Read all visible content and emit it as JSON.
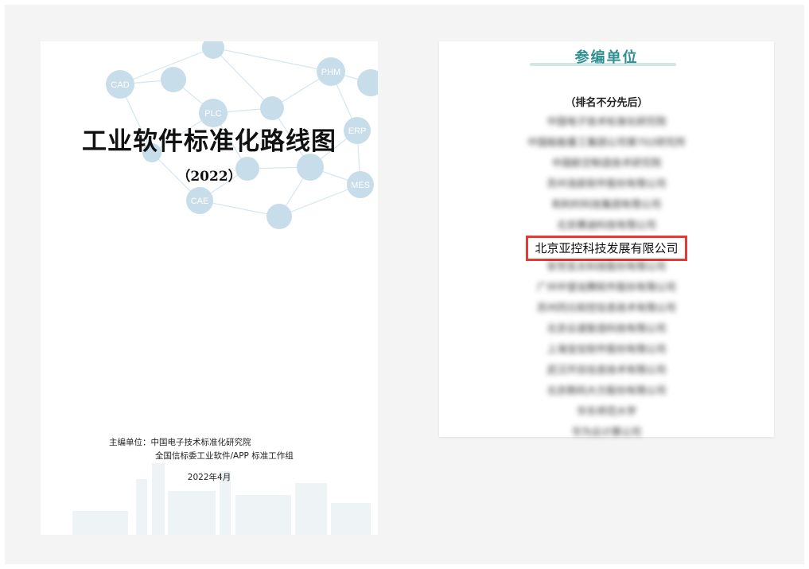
{
  "cover": {
    "title": "工业软件标准化路线图",
    "year": "（2022）",
    "network_labels": [
      "CAD",
      "PLC",
      "PHM",
      "ERP",
      "CAE",
      "MES"
    ],
    "chief_editor_label": "主编单位：",
    "chief_editor_1": "中国电子技术标准化研究院",
    "chief_editor_2": "全国信标委工业软件/APP 标准工作组",
    "date": "2022年4月"
  },
  "units": {
    "header": "参编单位",
    "note": "（排名不分先后）",
    "items": [
      "中国电子技术标准化研究院",
      "中国船舶重工集团公司第702研究所",
      "中国航空制造技术研究院",
      "苏州浩辰软件股份有限公司",
      "和利时科技集团有限公司",
      "北京赛迪科技有限公司",
      "北京亚控科技发展有限公司",
      "安世亚太科技股份有限公司",
      "广州中望龙腾软件股份有限公司",
      "苏州同元软控信息技术有限公司",
      "北京云道智造科技有限公司",
      "上海宝信软件股份有限公司",
      "武汉开目信息技术有限公司",
      "北京数码大方股份有限公司",
      "华东师范大学",
      "华为云计算公司"
    ],
    "highlighted_index": 6
  },
  "colors": {
    "accent": "#2f8f92",
    "highlight_border": "#e53935",
    "network": "#c7dde9"
  }
}
